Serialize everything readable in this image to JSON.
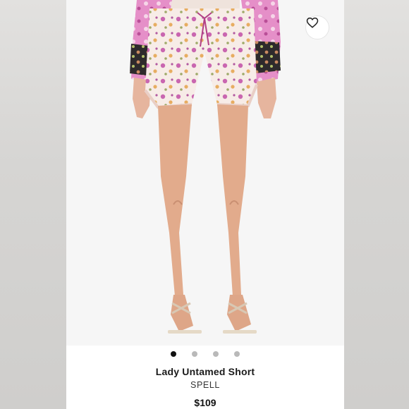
{
  "product": {
    "name": "Lady Untamed Short",
    "brand": "SPELL",
    "price": "$109"
  },
  "gallery": {
    "image_count": 4,
    "active_index": 0
  },
  "icons": {
    "favorite": "heart-outline-icon"
  },
  "colors": {
    "background": "#ffffff",
    "dot_active": "#111111",
    "dot_inactive": "#b9b9b9",
    "print_pink": "#d46fb5"
  }
}
